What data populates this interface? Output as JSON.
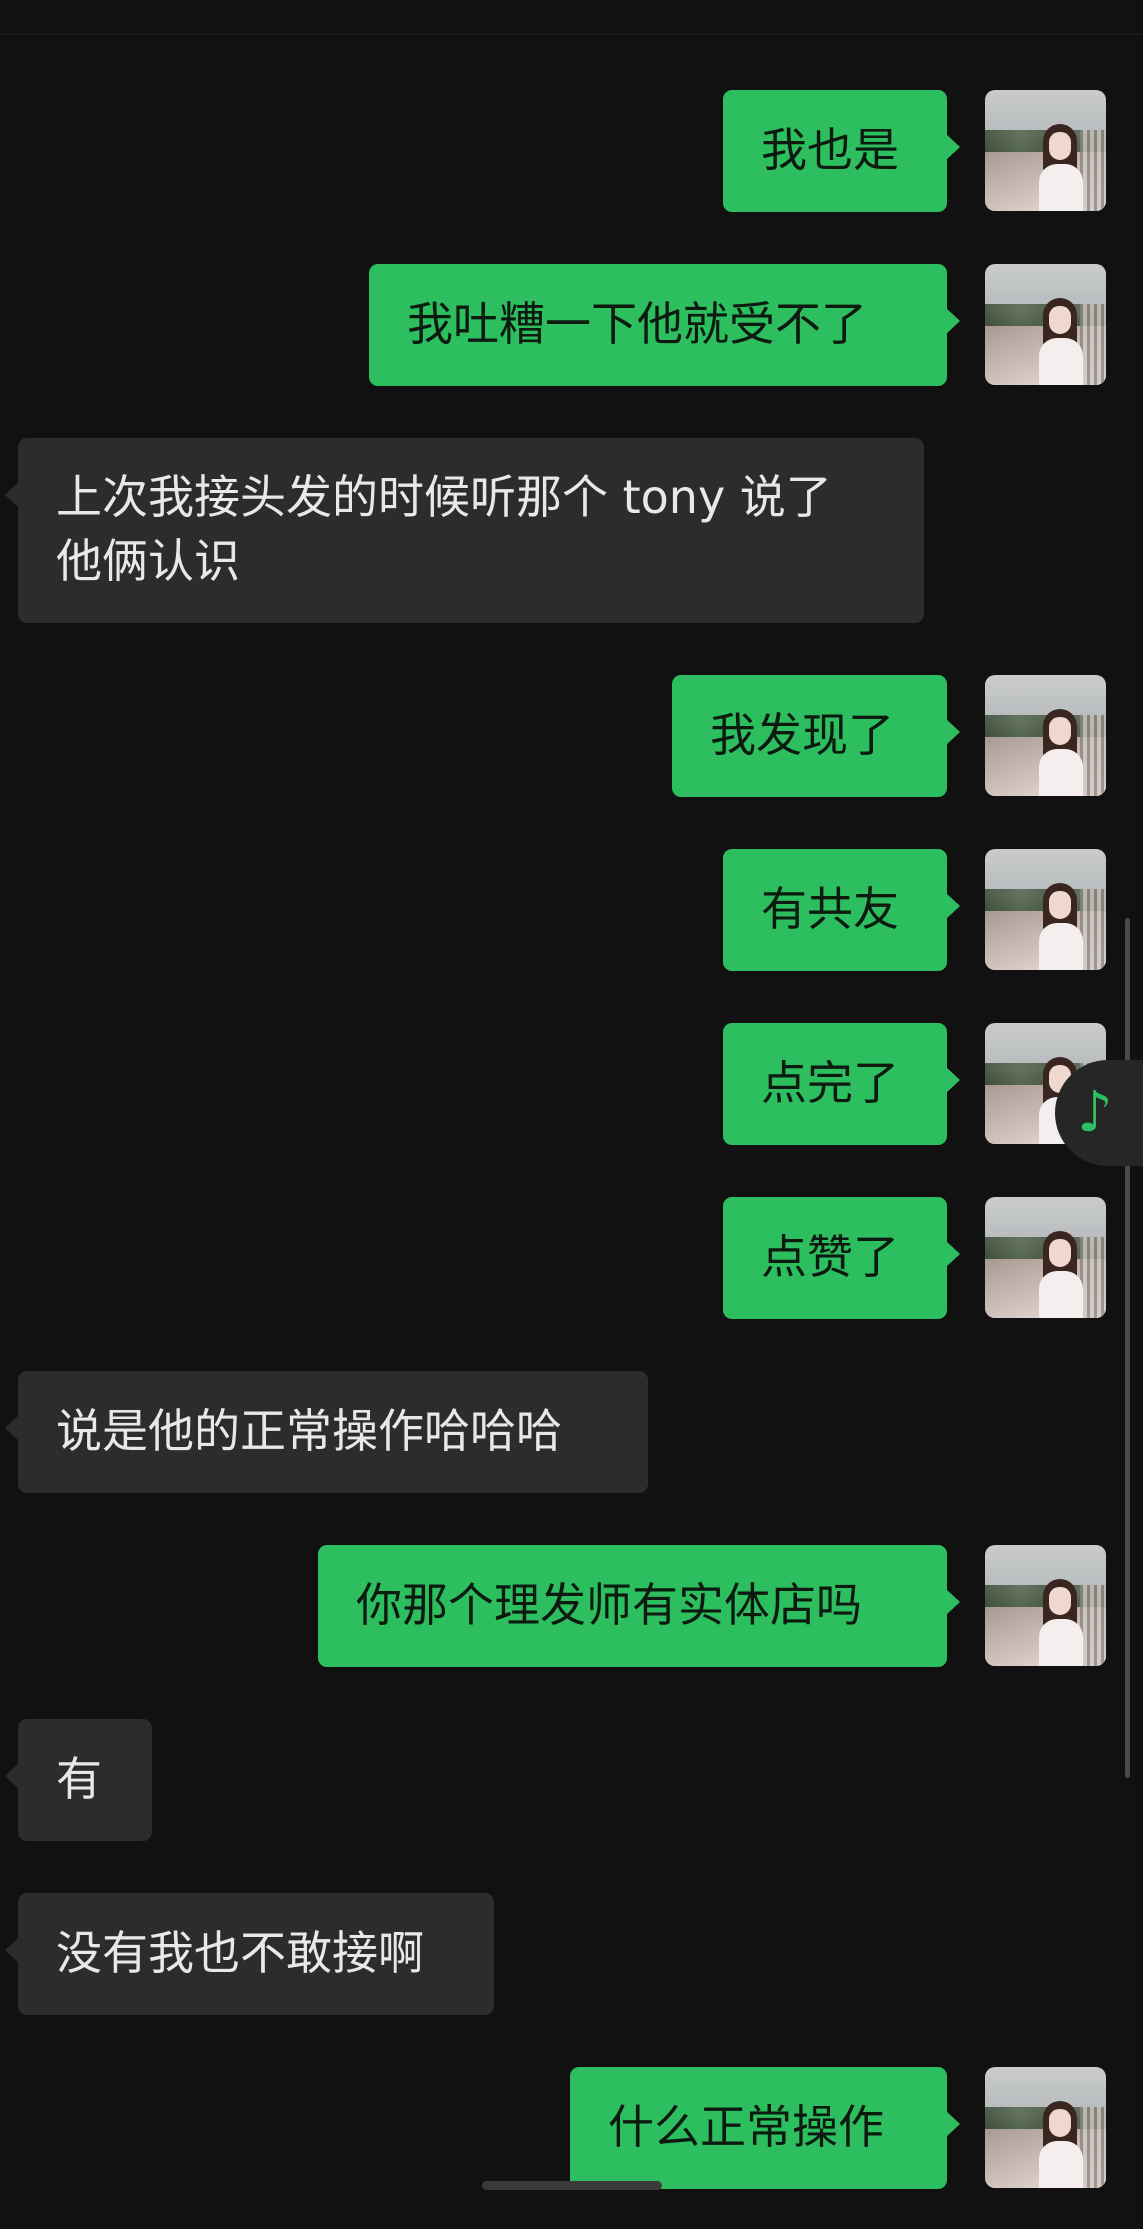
{
  "messages": [
    {
      "side": "sent",
      "text": "我也是"
    },
    {
      "side": "sent",
      "text": "我吐糟一下他就受不了"
    },
    {
      "side": "received",
      "text": "上次我接头发的时候听那个 tony 说了\n他俩认识"
    },
    {
      "side": "sent",
      "text": "我发现了"
    },
    {
      "side": "sent",
      "text": "有共友"
    },
    {
      "side": "sent",
      "text": "点完了"
    },
    {
      "side": "sent",
      "text": "点赞了"
    },
    {
      "side": "received",
      "text": "说是他的正常操作哈哈哈"
    },
    {
      "side": "sent",
      "text": "你那个理发师有实体店吗"
    },
    {
      "side": "received",
      "text": "有"
    },
    {
      "side": "received",
      "text": "没有我也不敢接啊"
    },
    {
      "side": "sent",
      "text": "什么正常操作"
    }
  ],
  "floating_player": {
    "icon": "music-note-icon"
  },
  "colors": {
    "background": "#111111",
    "sent_bubble": "#2dbf5f",
    "received_bubble": "#2c2c2c",
    "received_text": "#e8e8e8"
  }
}
